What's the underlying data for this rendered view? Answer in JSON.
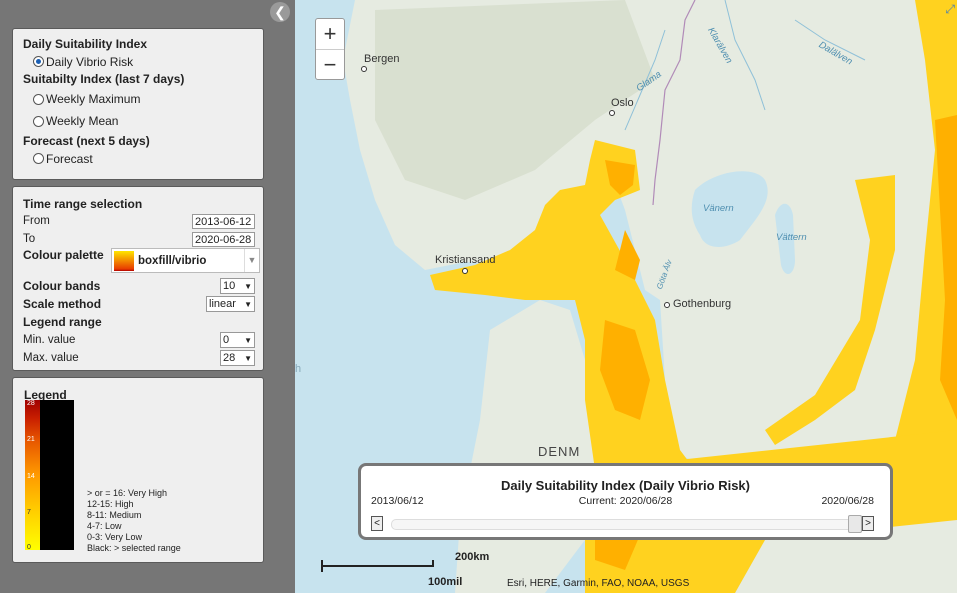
{
  "sidebar": {
    "collapse_glyph": "❮",
    "index_panel": {
      "daily_heading": "Daily Suitability Index",
      "daily_option": "Daily Vibrio Risk",
      "week_heading": "Suitabilty Index (last 7 days)",
      "weekly_max": "Weekly Maximum",
      "weekly_mean": "Weekly Mean",
      "forecast_heading": "Forecast (next 5 days)",
      "forecast_option": "Forecast"
    },
    "settings_panel": {
      "heading": "Time range selection",
      "from_label": "From",
      "from_value": "2013-06-12",
      "to_label": "To",
      "to_value": "2020-06-28",
      "palette_label": "Colour palette",
      "palette_value": "boxfill/vibrio",
      "bands_label": "Colour bands",
      "bands_value": "10",
      "scale_label": "Scale method",
      "scale_value": "linear",
      "range_label": "Legend range",
      "min_label": "Min. value",
      "min_value": "0",
      "max_label": "Max. value",
      "max_value": "28"
    },
    "legend_panel": {
      "heading": "Legend",
      "ticks": [
        "28",
        "21",
        "14",
        "7",
        "0"
      ],
      "notes": [
        "> or = 16: Very High",
        "12-15: High",
        "8-11: Medium",
        "4-7: Low",
        "0-3: Very Low",
        "Black: > selected range"
      ]
    }
  },
  "map": {
    "zoom_in": "+",
    "zoom_out": "−",
    "places": {
      "bergen": "Bergen",
      "oslo": "Oslo",
      "kristiansand": "Kristiansand",
      "gothenburg": "Gothenburg",
      "vanern": "Vänern",
      "vattern": "Vättern",
      "denmark": "DENM",
      "glama": "Glama",
      "klaralven": "Klarälven",
      "dalalven": "Dalälven",
      "gota_alv": "Göta Älv",
      "edge_h": "h"
    },
    "time_widget": {
      "title": "Daily Suitability Index (Daily Vibrio Risk)",
      "start": "2013/06/12",
      "current": "Current: 2020/06/28",
      "end": "2020/06/28",
      "prev": "<",
      "next": ">"
    },
    "scale": {
      "km": "200km",
      "mi": "100mil"
    },
    "attribution": "Esri, HERE, Garmin, FAO, NOAA, USGS"
  },
  "colors": {
    "low": "#ffe600",
    "mid": "#ffb000",
    "high": "#e83c00",
    "very_high": "#b00000",
    "land": "#e6ebe1",
    "water": "#c7e3ee"
  }
}
